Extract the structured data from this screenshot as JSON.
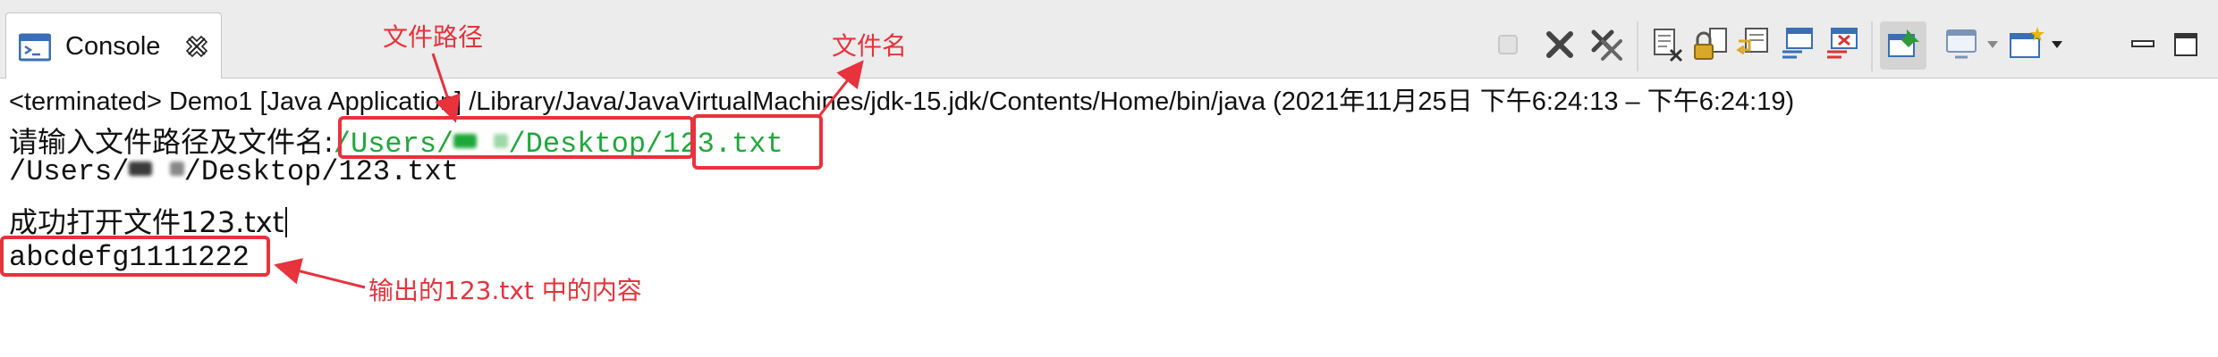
{
  "tab": {
    "label": "Console",
    "icon": "console-icon",
    "close_icon": "close-icon"
  },
  "toolbar": {
    "buttons": [
      "terminate-icon",
      "remove-launch-icon",
      "remove-all-terminated-icon",
      "clear-console-icon",
      "scroll-lock-icon",
      "word-wrap-icon",
      "show-on-stdout-icon",
      "show-on-stderr-icon",
      "pin-console-icon",
      "display-selected-console-icon",
      "open-console-icon"
    ],
    "window_controls": [
      "minimize-icon",
      "maximize-icon"
    ]
  },
  "status": {
    "text": "<terminated> Demo1 [Java Application] /Library/Java/JavaVirtualMachines/jdk-15.jdk/Contents/Home/bin/java  (2021年11月25日 下午6:24:13 – 下午6:24:19)"
  },
  "console": {
    "prompt": "请输入文件路径及文件名:",
    "input_path_start": "/Users/",
    "input_path_end": "/Desktop/",
    "input_file": "123.txt",
    "echo_start": "/Users/",
    "echo_end": "/Desktop/123.txt",
    "success": "成功打开文件123.txt",
    "content": "abcdefg1111222"
  },
  "annotations": {
    "file_path": "文件路径",
    "file_name": "文件名",
    "output_content": "输出的123.txt 中的内容"
  },
  "colors": {
    "annotation": "#e8323c",
    "input_text": "#1fa83a"
  }
}
